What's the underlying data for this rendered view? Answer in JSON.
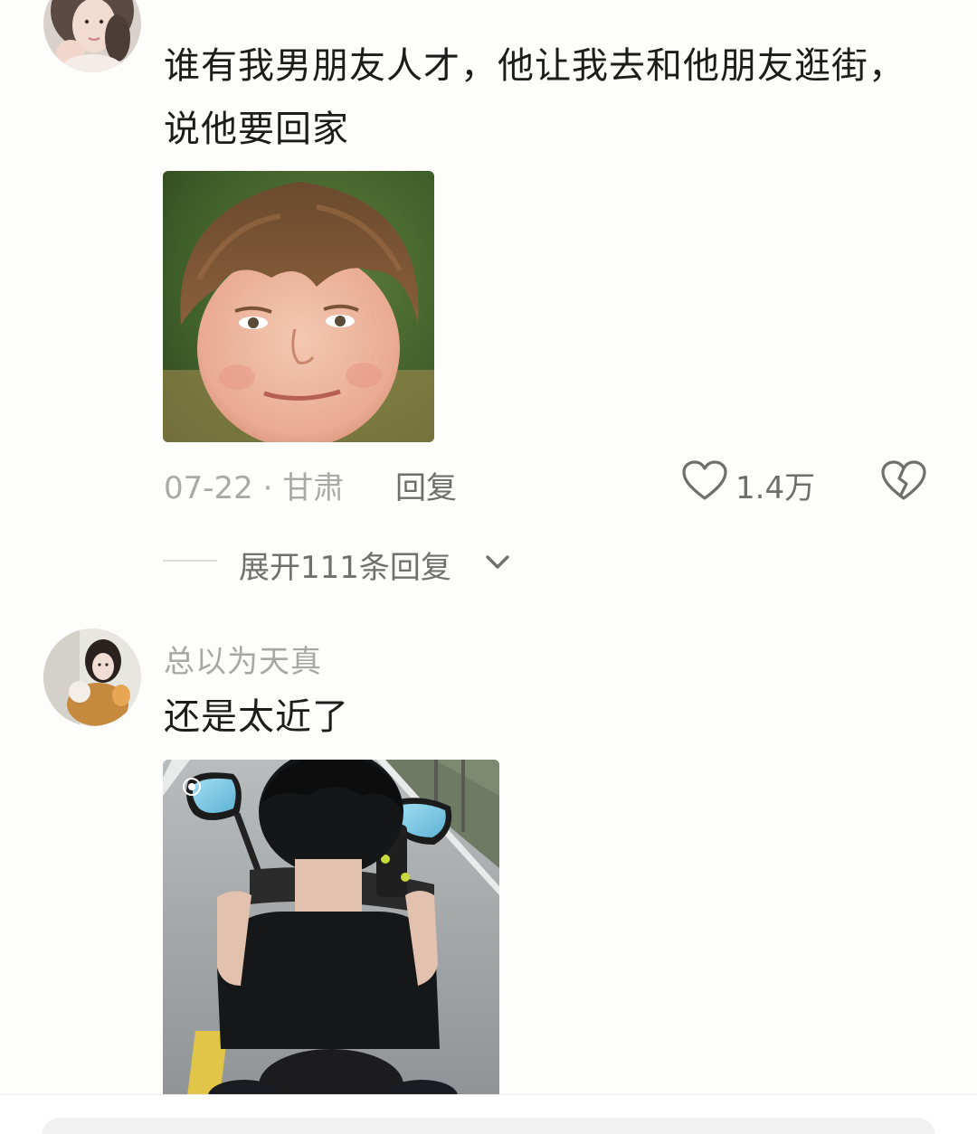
{
  "comments": [
    {
      "username": "",
      "text": "谁有我男朋友人才，他让我去和他朋友逛街，说他要回家",
      "date_location": "07-22 · 甘肃",
      "reply_label": "回复",
      "like_count": "1.4万",
      "expand_label": "展开111条回复"
    },
    {
      "username": "总以为天真",
      "text": "还是太近了"
    }
  ],
  "icons": {
    "like": "heart-outline-icon",
    "dislike": "broken-heart-icon",
    "expand": "chevron-down-icon"
  },
  "colors": {
    "background": "#fdfdfb",
    "text_primary": "#1c1c1c",
    "text_secondary": "#a9a9a9",
    "text_action": "#6e6e6e"
  }
}
